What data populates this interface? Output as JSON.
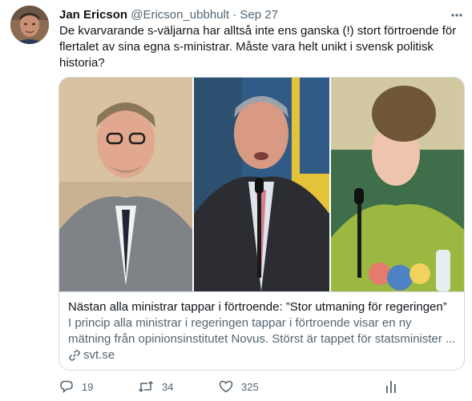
{
  "tweet": {
    "author_name": "Jan Ericson",
    "author_handle": "@Ericson_ubbhult",
    "separator": "·",
    "date": "Sep 27",
    "text": "De kvarvarande s-väljarna har alltså inte ens ganska (!) stort förtroende för flertalet av sina egna s-ministrar. Måste vara helt unikt i svensk politisk historia?"
  },
  "card": {
    "title": "Nästan alla ministrar tappar i förtroende: ”Stor utmaning för regeringen”",
    "description_lines": [
      "I princip alla ministrar i regeringen tappar i förtroende visar en ny",
      "mätning från opinionsinstitutet Novus. Störst är tappet för statsminister ..."
    ],
    "domain": "svt.se"
  },
  "actions": {
    "replies": "19",
    "retweets": "34",
    "likes": "325"
  },
  "icons": [
    "more-icon",
    "reply-icon",
    "retweet-icon",
    "like-icon",
    "analytics-icon",
    "link-icon"
  ],
  "colors": {
    "text": "#0f1419",
    "secondary": "#536471",
    "border": "#cfd9de"
  }
}
